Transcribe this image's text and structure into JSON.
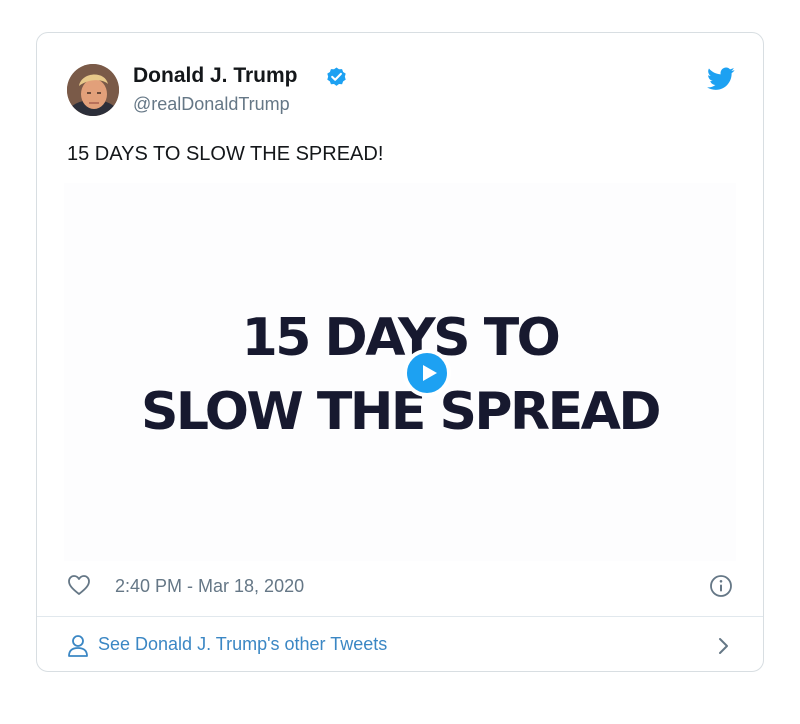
{
  "tweet": {
    "author": {
      "name": "Donald J. Trump",
      "handle": "@realDonaldTrump",
      "verified": true,
      "avatar": "avatar-photo"
    },
    "text": "15 DAYS TO SLOW THE SPREAD!",
    "media": {
      "type": "video",
      "headline_line1": "15 DAYS TO",
      "headline_line2": "SLOW THE SPREAD",
      "play_icon": "play-icon"
    },
    "timestamp": "2:40 PM - Mar 18, 2020",
    "footer_link_label": "See Donald J. Trump's other Tweets"
  },
  "icons": {
    "brand": "twitter-logo-icon",
    "verified": "verified-badge-icon",
    "like": "heart-icon",
    "info": "info-icon",
    "person": "person-icon",
    "chevron": "chevron-right-icon"
  },
  "colors": {
    "twitter_blue": "#1da1f2",
    "link_blue": "#3b87c4",
    "text_primary": "#14171a",
    "text_secondary": "#657786",
    "headline_navy": "#17192f",
    "border": "#d8dee2"
  }
}
